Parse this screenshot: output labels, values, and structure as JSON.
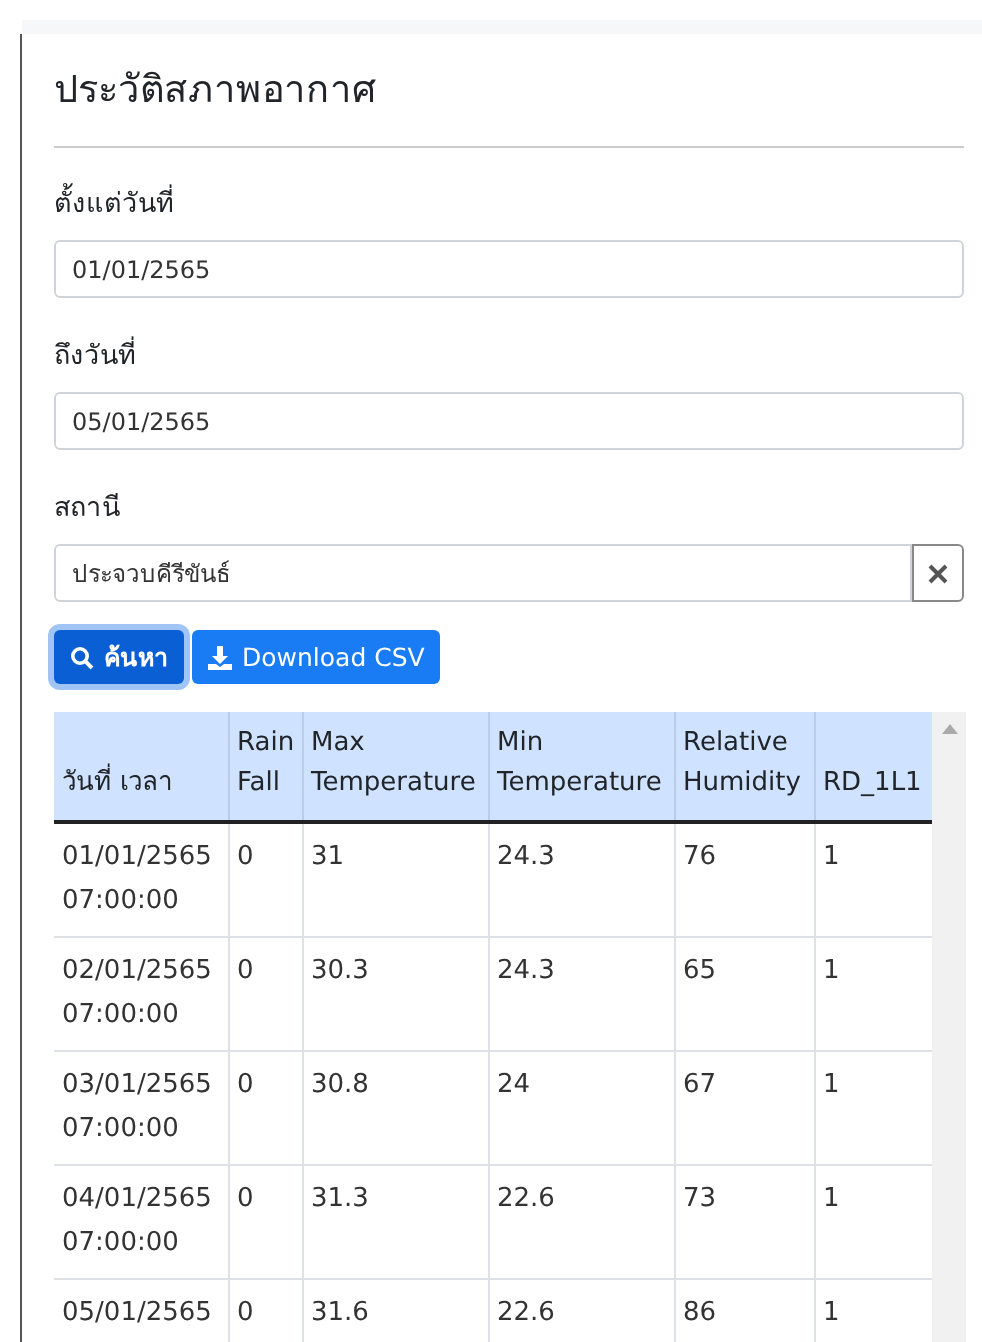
{
  "title": "ประวัติสภาพอากาศ",
  "fields": [
    {
      "label": "ตั้งแต่วันที่",
      "value": "01/01/2565"
    },
    {
      "label": "ถึงวันที่",
      "value": "05/01/2565"
    }
  ],
  "station": {
    "label": "สถานี",
    "value": "ประจวบคีรีขันธ์"
  },
  "buttons": [
    {
      "kind": "search",
      "label": "ค้นหา",
      "focused": true
    },
    {
      "kind": "download",
      "label": "Download CSV",
      "focused": false
    }
  ],
  "table": {
    "columns": [
      "วันที่ เวลา",
      "Rain Fall",
      "Max Temperature",
      "Min Temperature",
      "Relative Humidity",
      "RD_1L1"
    ],
    "rows": [
      [
        "01/01/2565 07:00:00",
        "0",
        "31",
        "24.3",
        "76",
        "1"
      ],
      [
        "02/01/2565 07:00:00",
        "0",
        "30.3",
        "24.3",
        "65",
        "1"
      ],
      [
        "03/01/2565 07:00:00",
        "0",
        "30.8",
        "24",
        "67",
        "1"
      ],
      [
        "04/01/2565 07:00:00",
        "0",
        "31.3",
        "22.6",
        "73",
        "1"
      ],
      [
        "05/01/2565",
        "0",
        "31.6",
        "22.6",
        "86",
        "1"
      ]
    ]
  }
}
